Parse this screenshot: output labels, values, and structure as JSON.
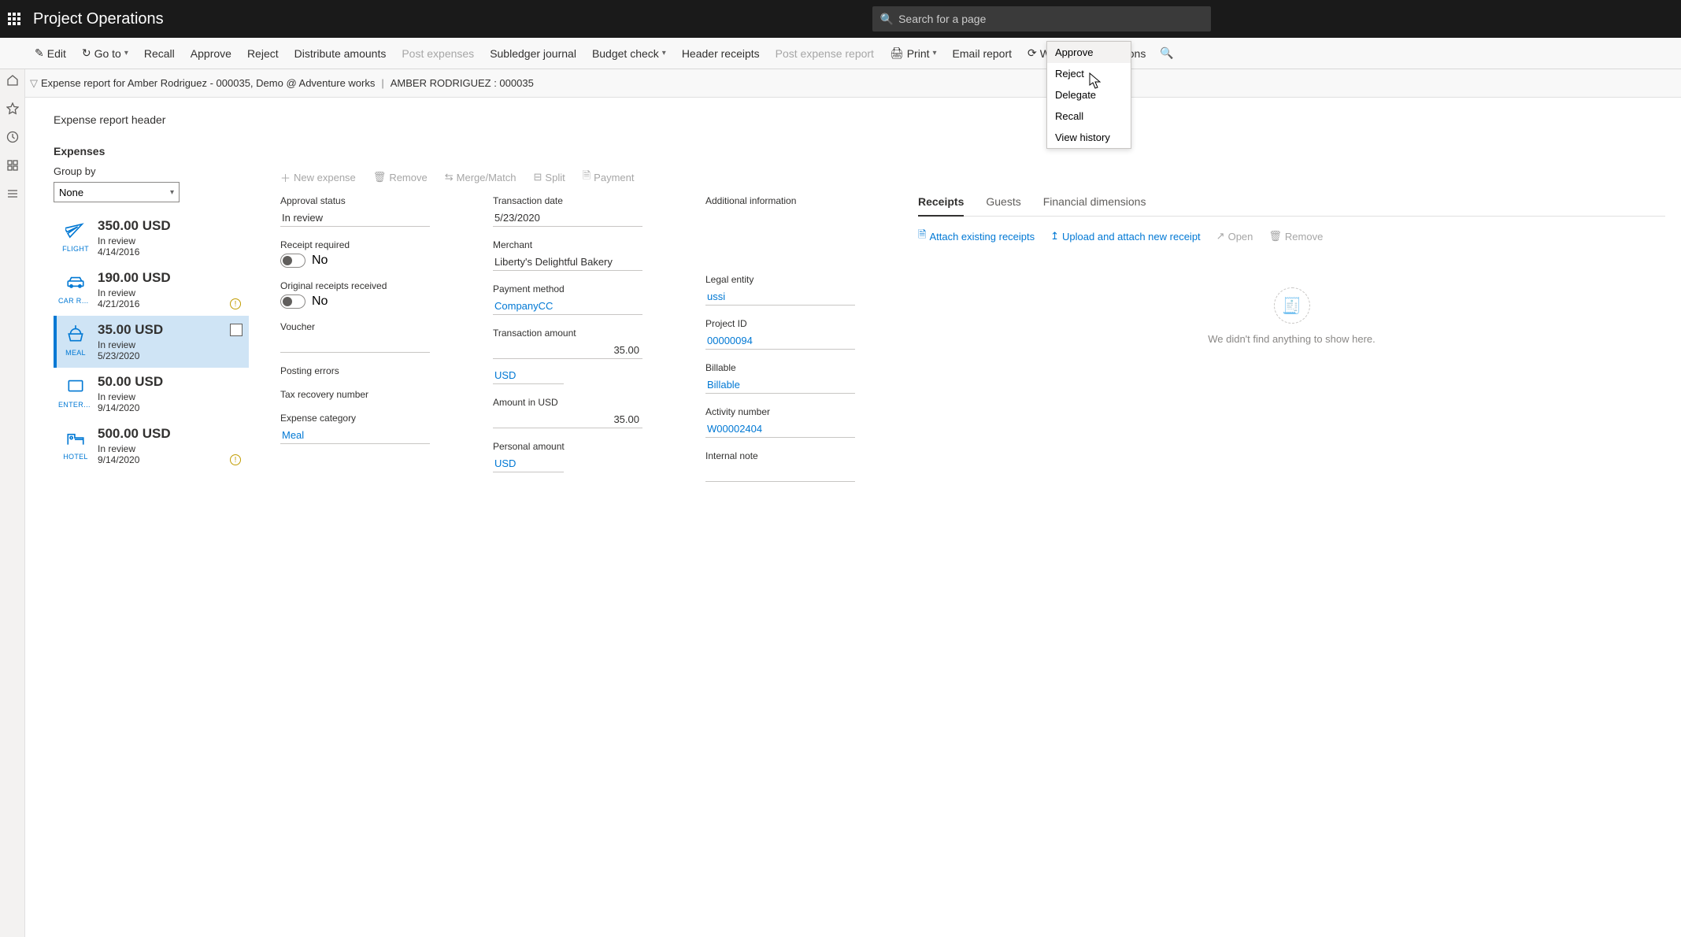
{
  "app": {
    "title": "Project Operations",
    "search_placeholder": "Search for a page"
  },
  "actions": {
    "edit": "Edit",
    "goto": "Go to",
    "recall": "Recall",
    "approve": "Approve",
    "reject": "Reject",
    "distribute": "Distribute amounts",
    "post_expenses": "Post expenses",
    "subledger": "Subledger journal",
    "budget": "Budget check",
    "header_receipts": "Header receipts",
    "post_report": "Post expense report",
    "print": "Print",
    "email": "Email report",
    "workflow": "Workflow",
    "options": "Options"
  },
  "breadcrumb": {
    "left": "Expense report for Amber Rodriguez - 000035, Demo @ Adventure works",
    "right": "AMBER RODRIGUEZ : 000035"
  },
  "section": {
    "header": "Expense report header",
    "expenses": "Expenses"
  },
  "group_by": {
    "label": "Group by",
    "value": "None"
  },
  "detail_toolbar": {
    "new": "New expense",
    "remove": "Remove",
    "merge": "Merge/Match",
    "split": "Split",
    "payment": "Payment"
  },
  "expenses": [
    {
      "amount": "350.00 USD",
      "status": "In review",
      "date": "4/14/2016",
      "category": "FLIGHT",
      "icon": "flight",
      "info": false
    },
    {
      "amount": "190.00 USD",
      "status": "In review",
      "date": "4/21/2016",
      "category": "CAR RE...",
      "icon": "car",
      "info": true
    },
    {
      "amount": "35.00 USD",
      "status": "In review",
      "date": "5/23/2020",
      "category": "MEAL",
      "icon": "meal",
      "selected": true,
      "check": true
    },
    {
      "amount": "50.00 USD",
      "status": "In review",
      "date": "9/14/2020",
      "category": "ENTERT...",
      "icon": "entertainment"
    },
    {
      "amount": "500.00 USD",
      "status": "In review",
      "date": "9/14/2020",
      "category": "HOTEL",
      "icon": "hotel",
      "info": true
    }
  ],
  "detail": {
    "approval_status": {
      "label": "Approval status",
      "value": "In review"
    },
    "receipt_required": {
      "label": "Receipt required",
      "value": "No"
    },
    "original_receipts": {
      "label": "Original receipts received",
      "value": "No"
    },
    "voucher": {
      "label": "Voucher",
      "value": ""
    },
    "posting_errors": {
      "label": "Posting errors",
      "value": ""
    },
    "tax_recovery": {
      "label": "Tax recovery number",
      "value": ""
    },
    "expense_category": {
      "label": "Expense category",
      "value": "Meal"
    },
    "transaction_date": {
      "label": "Transaction date",
      "value": "5/23/2020"
    },
    "merchant": {
      "label": "Merchant",
      "value": "Liberty's Delightful Bakery"
    },
    "payment_method": {
      "label": "Payment method",
      "value": "CompanyCC"
    },
    "transaction_amount": {
      "label": "Transaction amount",
      "value": "35.00",
      "currency": "USD"
    },
    "amount_usd": {
      "label": "Amount in USD",
      "value": "35.00",
      "currency": "USD"
    },
    "personal_amount": {
      "label": "Personal amount",
      "value": ""
    },
    "additional_info": {
      "label": "Additional information"
    },
    "legal_entity": {
      "label": "Legal entity",
      "value": "ussi"
    },
    "project_id": {
      "label": "Project ID",
      "value": "00000094"
    },
    "billable": {
      "label": "Billable",
      "value": "Billable"
    },
    "activity_number": {
      "label": "Activity number",
      "value": "W00002404"
    },
    "internal_note": {
      "label": "Internal note",
      "value": ""
    }
  },
  "tabs": {
    "receipts": "Receipts",
    "guests": "Guests",
    "financial": "Financial dimensions"
  },
  "rp_actions": {
    "attach": "Attach existing receipts",
    "upload": "Upload and attach new receipt",
    "open": "Open",
    "remove": "Remove"
  },
  "rp_empty": "We didn't find anything to show here.",
  "workflow_menu": [
    "Approve",
    "Reject",
    "Delegate",
    "Recall",
    "View history"
  ]
}
